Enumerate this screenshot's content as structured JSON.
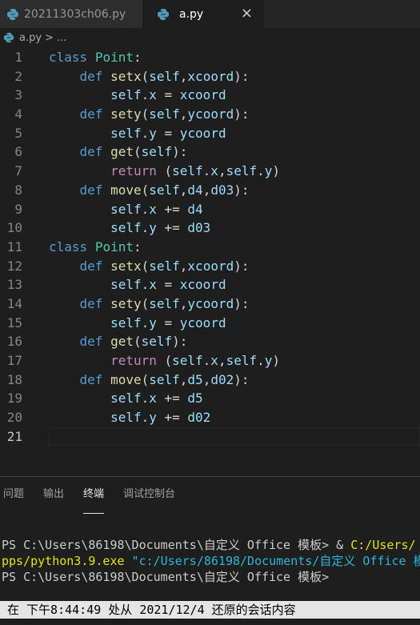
{
  "tabs": [
    {
      "label": "20211303ch06.py",
      "active": false
    },
    {
      "label": "a.py",
      "active": true
    }
  ],
  "tab_close_icon": "×",
  "breadcrumb": {
    "file": "a.py",
    "separator": ">",
    "rest": "..."
  },
  "code_lines": [
    {
      "num": "1",
      "tokens": [
        [
          "kw",
          "class"
        ],
        [
          "plain",
          " "
        ],
        [
          "cls",
          "Point"
        ],
        [
          "plain",
          ":"
        ]
      ]
    },
    {
      "num": "2",
      "tokens": [
        [
          "plain",
          "    "
        ],
        [
          "kw",
          "def"
        ],
        [
          "plain",
          " "
        ],
        [
          "fn",
          "setx"
        ],
        [
          "plain",
          "("
        ],
        [
          "var",
          "self"
        ],
        [
          "plain",
          ","
        ],
        [
          "var",
          "xcoord"
        ],
        [
          "plain",
          "):"
        ]
      ]
    },
    {
      "num": "3",
      "tokens": [
        [
          "plain",
          "        "
        ],
        [
          "var",
          "self"
        ],
        [
          "plain",
          "."
        ],
        [
          "var",
          "x"
        ],
        [
          "plain",
          " = "
        ],
        [
          "var",
          "xcoord"
        ]
      ]
    },
    {
      "num": "4",
      "tokens": [
        [
          "plain",
          "    "
        ],
        [
          "kw",
          "def"
        ],
        [
          "plain",
          " "
        ],
        [
          "fn",
          "sety"
        ],
        [
          "plain",
          "("
        ],
        [
          "var",
          "self"
        ],
        [
          "plain",
          ","
        ],
        [
          "var",
          "ycoord"
        ],
        [
          "plain",
          "):"
        ]
      ]
    },
    {
      "num": "5",
      "tokens": [
        [
          "plain",
          "        "
        ],
        [
          "var",
          "self"
        ],
        [
          "plain",
          "."
        ],
        [
          "var",
          "y"
        ],
        [
          "plain",
          " = "
        ],
        [
          "var",
          "ycoord"
        ]
      ]
    },
    {
      "num": "6",
      "tokens": [
        [
          "plain",
          "    "
        ],
        [
          "kw",
          "def"
        ],
        [
          "plain",
          " "
        ],
        [
          "fn",
          "get"
        ],
        [
          "plain",
          "("
        ],
        [
          "var",
          "self"
        ],
        [
          "plain",
          "):"
        ]
      ]
    },
    {
      "num": "7",
      "tokens": [
        [
          "plain",
          "        "
        ],
        [
          "kwc",
          "return"
        ],
        [
          "plain",
          " ("
        ],
        [
          "var",
          "self"
        ],
        [
          "plain",
          "."
        ],
        [
          "var",
          "x"
        ],
        [
          "plain",
          ","
        ],
        [
          "var",
          "self"
        ],
        [
          "plain",
          "."
        ],
        [
          "var",
          "y"
        ],
        [
          "plain",
          ")"
        ]
      ]
    },
    {
      "num": "8",
      "tokens": [
        [
          "plain",
          "    "
        ],
        [
          "kw",
          "def"
        ],
        [
          "plain",
          " "
        ],
        [
          "fn",
          "move"
        ],
        [
          "plain",
          "("
        ],
        [
          "var",
          "self"
        ],
        [
          "plain",
          ","
        ],
        [
          "var",
          "d4"
        ],
        [
          "plain",
          ","
        ],
        [
          "var",
          "d03"
        ],
        [
          "plain",
          "):"
        ]
      ]
    },
    {
      "num": "9",
      "tokens": [
        [
          "plain",
          "        "
        ],
        [
          "var",
          "self"
        ],
        [
          "plain",
          "."
        ],
        [
          "var",
          "x"
        ],
        [
          "plain",
          " += "
        ],
        [
          "var",
          "d4"
        ]
      ]
    },
    {
      "num": "10",
      "tokens": [
        [
          "plain",
          "        "
        ],
        [
          "var",
          "self"
        ],
        [
          "plain",
          "."
        ],
        [
          "var",
          "y"
        ],
        [
          "plain",
          " += "
        ],
        [
          "var",
          "d03"
        ]
      ]
    },
    {
      "num": "11",
      "tokens": [
        [
          "kw",
          "class"
        ],
        [
          "plain",
          " "
        ],
        [
          "cls",
          "Point"
        ],
        [
          "plain",
          ":"
        ]
      ]
    },
    {
      "num": "12",
      "tokens": [
        [
          "plain",
          "    "
        ],
        [
          "kw",
          "def"
        ],
        [
          "plain",
          " "
        ],
        [
          "fn",
          "setx"
        ],
        [
          "plain",
          "("
        ],
        [
          "var",
          "self"
        ],
        [
          "plain",
          ","
        ],
        [
          "var",
          "xcoord"
        ],
        [
          "plain",
          "):"
        ]
      ]
    },
    {
      "num": "13",
      "tokens": [
        [
          "plain",
          "        "
        ],
        [
          "var",
          "self"
        ],
        [
          "plain",
          "."
        ],
        [
          "var",
          "x"
        ],
        [
          "plain",
          " = "
        ],
        [
          "var",
          "xcoord"
        ]
      ]
    },
    {
      "num": "14",
      "tokens": [
        [
          "plain",
          "    "
        ],
        [
          "kw",
          "def"
        ],
        [
          "plain",
          " "
        ],
        [
          "fn",
          "sety"
        ],
        [
          "plain",
          "("
        ],
        [
          "var",
          "self"
        ],
        [
          "plain",
          ","
        ],
        [
          "var",
          "ycoord"
        ],
        [
          "plain",
          "):"
        ]
      ]
    },
    {
      "num": "15",
      "tokens": [
        [
          "plain",
          "        "
        ],
        [
          "var",
          "self"
        ],
        [
          "plain",
          "."
        ],
        [
          "var",
          "y"
        ],
        [
          "plain",
          " = "
        ],
        [
          "var",
          "ycoord"
        ]
      ]
    },
    {
      "num": "16",
      "tokens": [
        [
          "plain",
          "    "
        ],
        [
          "kw",
          "def"
        ],
        [
          "plain",
          " "
        ],
        [
          "fn",
          "get"
        ],
        [
          "plain",
          "("
        ],
        [
          "var",
          "self"
        ],
        [
          "plain",
          "):"
        ]
      ]
    },
    {
      "num": "17",
      "tokens": [
        [
          "plain",
          "        "
        ],
        [
          "kwc",
          "return"
        ],
        [
          "plain",
          " ("
        ],
        [
          "var",
          "self"
        ],
        [
          "plain",
          "."
        ],
        [
          "var",
          "x"
        ],
        [
          "plain",
          ","
        ],
        [
          "var",
          "self"
        ],
        [
          "plain",
          "."
        ],
        [
          "var",
          "y"
        ],
        [
          "plain",
          ")"
        ]
      ]
    },
    {
      "num": "18",
      "tokens": [
        [
          "plain",
          "    "
        ],
        [
          "kw",
          "def"
        ],
        [
          "plain",
          " "
        ],
        [
          "fn",
          "move"
        ],
        [
          "plain",
          "("
        ],
        [
          "var",
          "self"
        ],
        [
          "plain",
          ","
        ],
        [
          "var",
          "d5"
        ],
        [
          "plain",
          ","
        ],
        [
          "var",
          "d02"
        ],
        [
          "plain",
          "):"
        ]
      ]
    },
    {
      "num": "19",
      "tokens": [
        [
          "plain",
          "        "
        ],
        [
          "var",
          "self"
        ],
        [
          "plain",
          "."
        ],
        [
          "var",
          "x"
        ],
        [
          "plain",
          " += "
        ],
        [
          "var",
          "d5"
        ]
      ]
    },
    {
      "num": "20",
      "tokens": [
        [
          "plain",
          "        "
        ],
        [
          "var",
          "self"
        ],
        [
          "plain",
          "."
        ],
        [
          "var",
          "y"
        ],
        [
          "plain",
          " += "
        ],
        [
          "var",
          "d02"
        ]
      ]
    },
    {
      "num": "21",
      "tokens": []
    }
  ],
  "panel_tabs": [
    {
      "label": "问题",
      "active": false
    },
    {
      "label": "输出",
      "active": false
    },
    {
      "label": "终端",
      "active": true
    },
    {
      "label": "调试控制台",
      "active": false
    }
  ],
  "terminal": {
    "line1_prompt": "PS C:\\Users\\86198\\Documents\\自定义 Office 模板> & ",
    "line1_path": "C:/Users/",
    "line2_path": "pps/python3.9.exe",
    "line2_arg": " \"c:/Users/86198/Documents/自定义 Office 模",
    "line3": "PS C:\\Users\\86198\\Documents\\自定义 Office 模板>",
    "status": " 在 下午8:44:49 处从 2021/12/4 还原的会话内容"
  },
  "colors": {
    "editor_bg": "#1e1e1e",
    "keyword": "#569cd6",
    "class_name": "#4ec9b0",
    "function": "#dcdcaa",
    "variable": "#9cdcfe",
    "control_keyword": "#c586c0",
    "python_icon": "#3776ab"
  }
}
